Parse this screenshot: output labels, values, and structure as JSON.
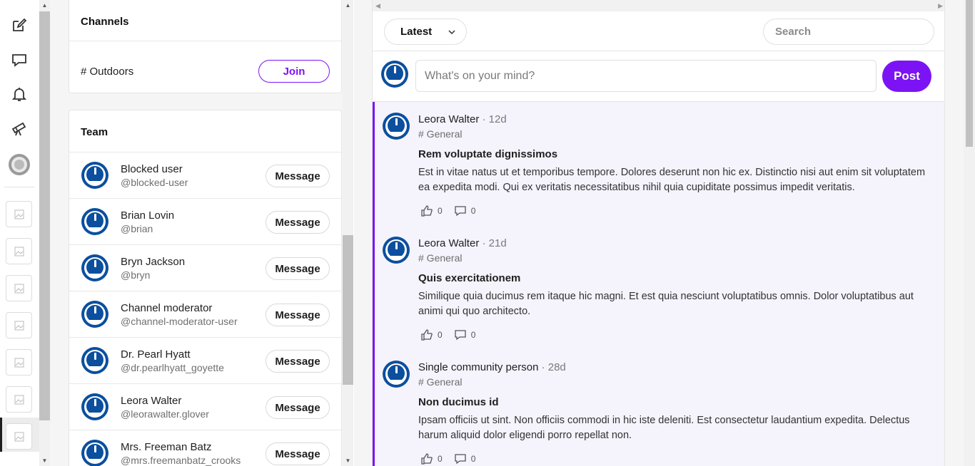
{
  "rail": {
    "icons": [
      "compose-icon",
      "chat-icon",
      "bell-icon",
      "telescope-icon",
      "user-avatar"
    ],
    "community_thumbs": 7
  },
  "channels": {
    "title": "Channels",
    "items": [
      {
        "label": "# Outdoors",
        "action": "Join"
      }
    ]
  },
  "team": {
    "title": "Team",
    "members": [
      {
        "name": "Blocked user",
        "handle": "@blocked-user",
        "action": "Message"
      },
      {
        "name": "Brian Lovin",
        "handle": "@brian",
        "action": "Message"
      },
      {
        "name": "Bryn Jackson",
        "handle": "@bryn",
        "action": "Message"
      },
      {
        "name": "Channel moderator",
        "handle": "@channel-moderator-user",
        "action": "Message"
      },
      {
        "name": "Dr. Pearl Hyatt",
        "handle": "@dr.pearlhyatt_goyette",
        "action": "Message"
      },
      {
        "name": "Leora Walter",
        "handle": "@leorawalter.glover",
        "action": "Message"
      },
      {
        "name": "Mrs. Freeman Batz",
        "handle": "@mrs.freemanbatz_crooks",
        "action": "Message"
      }
    ]
  },
  "feed": {
    "sort_label": "Latest",
    "search_placeholder": "Search",
    "composer_placeholder": "What's on your mind?",
    "post_button": "Post",
    "posts": [
      {
        "author": "Leora Walter",
        "time": " · 12d",
        "channel": "# General",
        "title": "Rem voluptate dignissimos",
        "body": "Est in vitae natus ut et temporibus tempore. Dolores deserunt non hic ex. Distinctio nisi aut enim sit voluptatem ea expedita modi. Qui ex veritatis necessitatibus nihil quia cupiditate possimus impedit veritatis.",
        "likes": "0",
        "comments": "0"
      },
      {
        "author": "Leora Walter",
        "time": " · 21d",
        "channel": "# General",
        "title": "Quis exercitationem",
        "body": "Similique quia ducimus rem itaque hic magni. Et est quia nesciunt voluptatibus omnis. Dolor voluptatibus aut animi qui quo architecto.",
        "likes": "0",
        "comments": "0"
      },
      {
        "author": "Single community person",
        "time": " · 28d",
        "channel": "# General",
        "title": "Non ducimus id",
        "body": "Ipsam officiis ut sint. Non officiis commodi in hic iste deleniti. Est consectetur laudantium expedita. Delectus harum aliquid dolor eligendi porro repellat non.",
        "likes": "0",
        "comments": "0"
      }
    ]
  },
  "colors": {
    "accent": "#7c13f4",
    "post_bg": "#f5f3fc",
    "avatar": "#0b4f9e"
  }
}
